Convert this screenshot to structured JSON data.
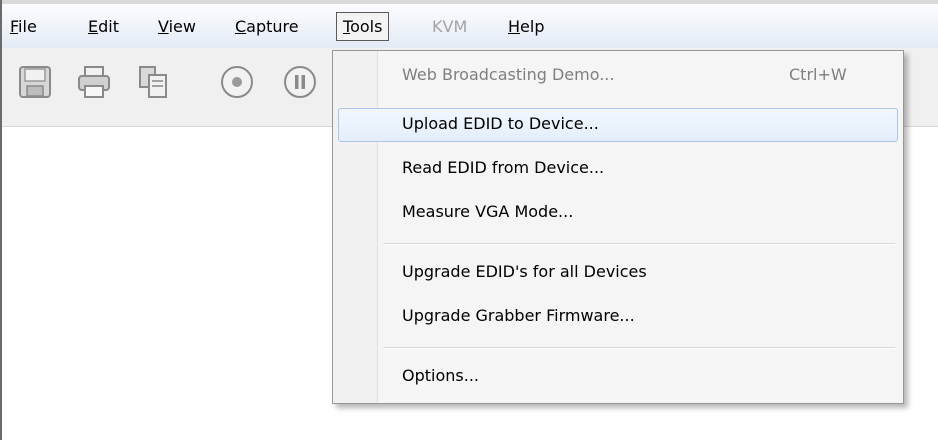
{
  "menubar": {
    "file_label": "File",
    "edit_label": "Edit",
    "view_label": "View",
    "capture_label": "Capture",
    "tools_label": "Tools",
    "kvm_label": "KVM",
    "help_label": "Help"
  },
  "toolbar": {
    "buttons": [
      "save-icon",
      "print-icon",
      "copy-icon",
      "record-icon",
      "pause-icon"
    ]
  },
  "tools_menu": {
    "items": [
      {
        "label": "Web Broadcasting Demo...",
        "shortcut": "Ctrl+W",
        "enabled": false
      },
      {
        "label": "Upload EDID to Device...",
        "highlighted": true
      },
      {
        "label": "Read EDID from Device..."
      },
      {
        "label": "Measure VGA Mode..."
      },
      {
        "label": "Upgrade EDID's for all Devices"
      },
      {
        "label": "Upgrade Grabber Firmware..."
      },
      {
        "label": "Options..."
      }
    ]
  },
  "colors": {
    "highlight_border": "#a9c7ec",
    "disabled_text": "#7f7f7f",
    "menubar_gradient_end": "#e4ebf5"
  }
}
